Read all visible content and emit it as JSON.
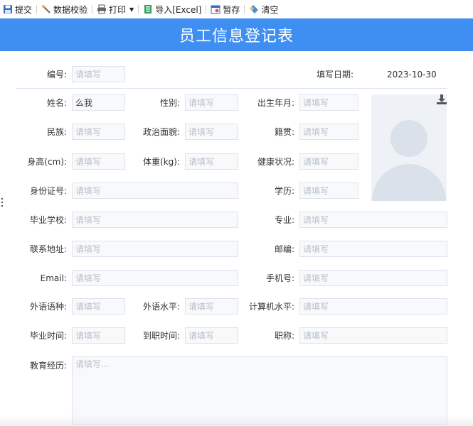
{
  "toolbar": {
    "submit": "提交",
    "validate": "数据校验",
    "print": "打印",
    "import": "导入[Excel]",
    "save_draft": "暂存",
    "clear": "清空"
  },
  "form": {
    "title": "员工信息登记表",
    "placeholder": "请填写",
    "textarea_placeholder": "请填写...",
    "id": {
      "label": "编号:",
      "value": ""
    },
    "fill_date": {
      "label": "填写日期:",
      "value": "2023-10-30"
    },
    "name": {
      "label": "姓名:",
      "value": "么我"
    },
    "gender": {
      "label": "性别:",
      "value": ""
    },
    "birth": {
      "label": "出生年月:",
      "value": ""
    },
    "ethnicity": {
      "label": "民族:",
      "value": ""
    },
    "political": {
      "label": "政治面貌:",
      "value": ""
    },
    "native_place": {
      "label": "籍贯:",
      "value": ""
    },
    "height": {
      "label": "身高(cm):",
      "value": ""
    },
    "weight": {
      "label": "体重(kg):",
      "value": ""
    },
    "health": {
      "label": "健康状况:",
      "value": ""
    },
    "id_card": {
      "label": "身份证号:",
      "value": ""
    },
    "education": {
      "label": "学历:",
      "value": ""
    },
    "school": {
      "label": "毕业学校:",
      "value": ""
    },
    "major": {
      "label": "专业:",
      "value": ""
    },
    "address": {
      "label": "联系地址:",
      "value": ""
    },
    "postcode": {
      "label": "邮编:",
      "value": ""
    },
    "email": {
      "label": "Email:",
      "value": ""
    },
    "phone": {
      "label": "手机号:",
      "value": ""
    },
    "language": {
      "label": "外语语种:",
      "value": ""
    },
    "language_level": {
      "label": "外语水平:",
      "value": ""
    },
    "computer_level": {
      "label": "计算机水平:",
      "value": ""
    },
    "graduation_time": {
      "label": "毕业时间:",
      "value": ""
    },
    "entry_time": {
      "label": "到职时间:",
      "value": ""
    },
    "job_title": {
      "label": "职称:",
      "value": ""
    },
    "edu_history": {
      "label": "教育经历:",
      "value": ""
    }
  },
  "colors": {
    "title_bar": "#3f8ef2",
    "input_border": "#dde3ec",
    "photo_bg": "#eef1f6",
    "avatar_silhouette": "#dbe1eb"
  },
  "icons": {
    "submit": "save-disk-icon",
    "validate": "wand-icon",
    "print": "printer-icon",
    "import": "excel-icon",
    "save_draft": "calendar-icon",
    "clear": "eraser-icon",
    "photo_download": "download-icon",
    "side_handle": "vertical-dots-icon"
  }
}
